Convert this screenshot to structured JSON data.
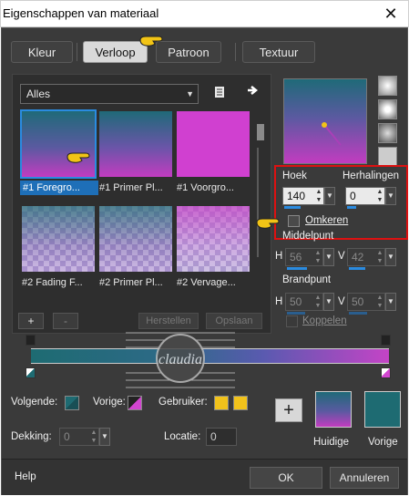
{
  "window": {
    "title": "Eigenschappen van materiaal",
    "close_glyph": "✕"
  },
  "tabs": [
    {
      "label": "Kleur",
      "active": false
    },
    {
      "label": "Verloop",
      "active": true
    },
    {
      "label": "Patroon",
      "active": false
    },
    {
      "label": "Textuur",
      "active": false
    }
  ],
  "library": {
    "category": "Alles",
    "items": [
      {
        "label": "#1 Foregro...",
        "selected": true
      },
      {
        "label": "#1 Primer Pl...",
        "selected": false
      },
      {
        "label": "#1 Voorgro...",
        "selected": false
      },
      {
        "label": "#2 Fading F...",
        "selected": false
      },
      {
        "label": "#2 Primer Pl...",
        "selected": false
      },
      {
        "label": "#2 Vervage...",
        "selected": false
      }
    ],
    "add_label": "+",
    "remove_label": "-",
    "restore_label": "Herstellen",
    "save_label": "Opslaan"
  },
  "angle": {
    "label": "Hoek",
    "value": "140"
  },
  "repeats": {
    "label": "Herhalingen",
    "value": "0"
  },
  "invert": {
    "label": "Omkeren",
    "checked": false
  },
  "center": {
    "label": "Middelpunt",
    "h_label": "H",
    "h_value": "56",
    "v_label": "V",
    "v_value": "42"
  },
  "focal": {
    "label": "Brandpunt",
    "h_label": "H",
    "h_value": "50",
    "v_label": "V",
    "v_value": "50",
    "link_label": "Koppelen"
  },
  "stops": {
    "next_label": "Volgende:",
    "prev_label": "Vorige:",
    "user_label": "Gebruiker:",
    "opacity_label": "Dekking:",
    "opacity_value": "0",
    "location_label": "Locatie:",
    "location_value": "0"
  },
  "current": {
    "label": "Huidige"
  },
  "previous": {
    "label": "Vorige"
  },
  "footer": {
    "help": "Help",
    "ok": "OK",
    "cancel": "Annuleren"
  },
  "watermark": "claudia",
  "colors": {
    "teal": "#1e6b72",
    "magenta": "#d245d0",
    "yellow": "#f1c21b",
    "accent": "#2a8be0",
    "highlight": "#d11111"
  }
}
